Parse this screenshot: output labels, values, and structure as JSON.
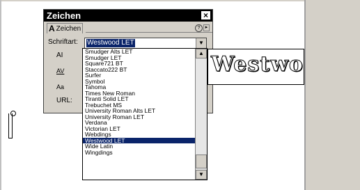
{
  "panel": {
    "title": "Zeichen",
    "close_label": "×",
    "tab_label": "Zeichen",
    "font_label": "Schriftart:",
    "font_value": "Westwood LET",
    "url_label": "URL:"
  },
  "icons": {
    "ai": "AI",
    "av": "AV",
    "aa": "Aa"
  },
  "dropdown": {
    "items": [
      "Smudger Alts LET",
      "Smudger LET",
      "Square721 BT",
      "Staccato222 BT",
      "Surfer",
      "Symbol",
      "Tahoma",
      "Times New Roman",
      "Tiranti Solid LET",
      "Trebuchet MS",
      "University Roman Alts LET",
      "University Roman LET",
      "Verdana",
      "Victorian LET",
      "Webdings",
      "Westwood LET",
      "Wide Latin",
      "Wingdings"
    ],
    "selected_index": 15
  },
  "preview": {
    "text": "Westwood I"
  },
  "colors": {
    "selection": "#0a246a",
    "titlebar": "#000000",
    "panel": "#d4d0c8"
  }
}
